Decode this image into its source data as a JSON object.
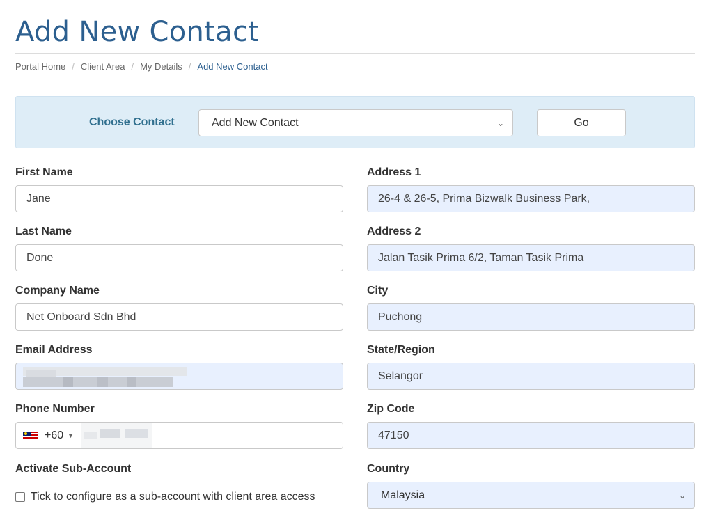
{
  "page": {
    "title": "Add New Contact"
  },
  "breadcrumb": {
    "items": [
      "Portal Home",
      "Client Area",
      "My Details"
    ],
    "separator": "/",
    "active": "Add New Contact"
  },
  "chooser": {
    "label": "Choose Contact",
    "selected": "Add New Contact",
    "go_label": "Go"
  },
  "form": {
    "first_name": {
      "label": "First Name",
      "value": "Jane"
    },
    "last_name": {
      "label": "Last Name",
      "value": "Done"
    },
    "company": {
      "label": "Company Name",
      "value": "Net Onboard Sdn Bhd"
    },
    "email": {
      "label": "Email Address"
    },
    "phone": {
      "label": "Phone Number",
      "dial_code": "+60"
    },
    "sub_account": {
      "label": "Activate Sub-Account",
      "checkbox_text": "Tick to configure as a sub-account with client area access",
      "checked": false
    },
    "address1": {
      "label": "Address 1",
      "value": "26-4 & 26-5, Prima Bizwalk Business Park,"
    },
    "address2": {
      "label": "Address 2",
      "value": "Jalan Tasik Prima 6/2, Taman Tasik Prima"
    },
    "city": {
      "label": "City",
      "value": "Puchong"
    },
    "state": {
      "label": "State/Region",
      "value": "Selangor"
    },
    "zip": {
      "label": "Zip Code",
      "value": "47150"
    },
    "country": {
      "label": "Country",
      "value": "Malaysia"
    }
  },
  "icons": {
    "select_chevron": "chevron-down-icon",
    "phone_flag": "malaysia-flag-icon",
    "dial_caret": "caret-down-icon"
  },
  "colors": {
    "title": "#2c5f8f",
    "panel_bg": "#deedf7",
    "panel_label": "#31708f",
    "autofill_bg": "#e8f0fe"
  }
}
